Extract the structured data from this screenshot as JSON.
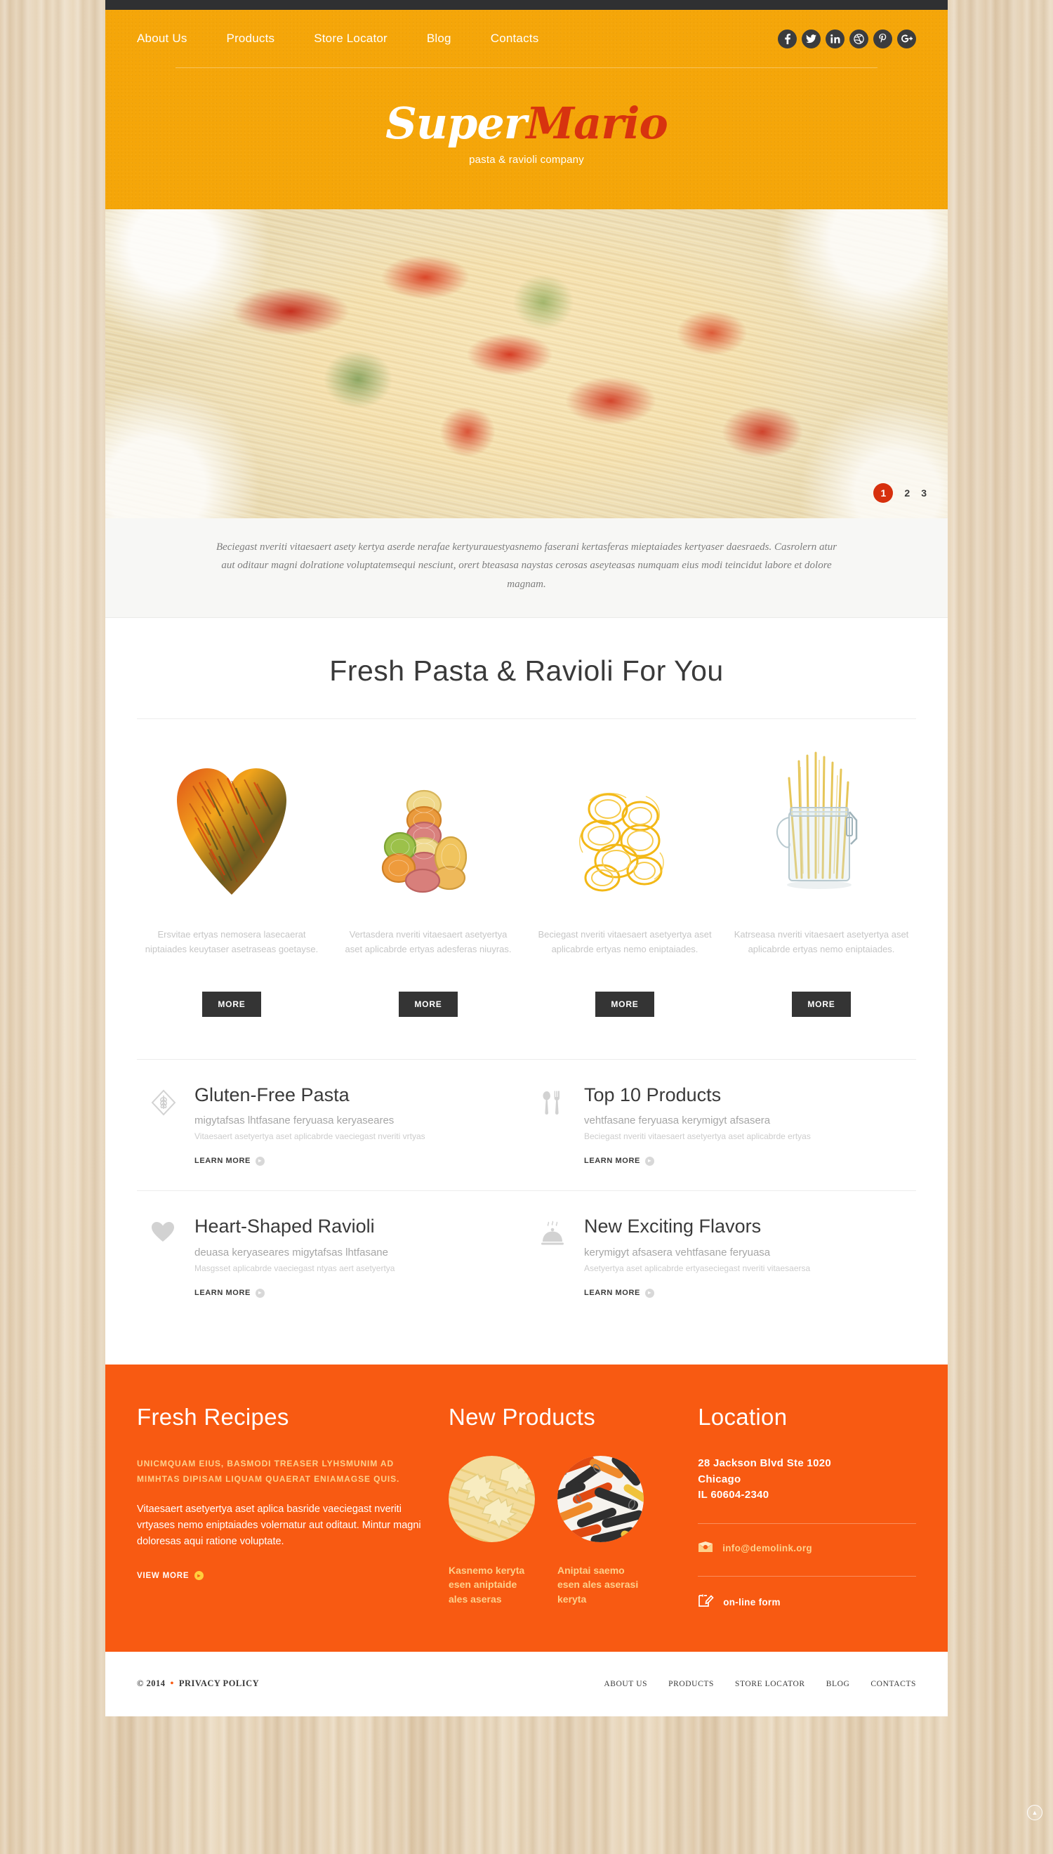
{
  "header": {
    "nav": [
      {
        "label": "About Us"
      },
      {
        "label": "Products"
      },
      {
        "label": "Store Locator"
      },
      {
        "label": "Blog"
      },
      {
        "label": "Contacts"
      }
    ],
    "socials": [
      {
        "name": "facebook-icon",
        "glyph": "f"
      },
      {
        "name": "twitter-icon",
        "glyph": "t"
      },
      {
        "name": "linkedin-icon",
        "glyph": "in"
      },
      {
        "name": "dribbble-icon",
        "glyph": "d"
      },
      {
        "name": "pinterest-icon",
        "glyph": "P"
      },
      {
        "name": "googleplus-icon",
        "glyph": "g+"
      }
    ],
    "logo_part1": "Super",
    "logo_part2": "Mario",
    "tagline": "pasta & ravioli company",
    "bg_color": "#f5a609",
    "accent_red": "#d7330f"
  },
  "slider": {
    "pager": [
      {
        "label": "1",
        "active": true
      },
      {
        "label": "2",
        "active": false
      },
      {
        "label": "3",
        "active": false
      }
    ],
    "active_color": "#d7300d",
    "caption": "Beciegast nveriti vitaesaert asety kertya aserde nerafae kertyurauestyasnemo faserani kertasferas mieptaiades kertyaser daesraeds. Casrolern atur aut oditaur magni dolratione voluptatemsequi nesciunt, orert bteasasa naystas cerosas aseyteasas numquam eius modi teincidut labore et dolore magnam."
  },
  "main": {
    "section_title": "Fresh Pasta & Ravioli For You",
    "products": [
      {
        "image": "heart-shaped-pasta",
        "desc": "Ersvitae ertyas nemosera lasecaerat niptaiades keuytaser asetraseas goetayse.",
        "button": "MORE"
      },
      {
        "image": "colored-pasta-nests",
        "desc": "Vertasdera nveriti vitaesaert asetyertya aset aplicabrde ertyas adesferas niuyras.",
        "button": "MORE"
      },
      {
        "image": "yellow-pasta-nests",
        "desc": "Beciegast nveriti vitaesaert asetyertya aset aplicabrde ertyas nemo eniptaiades.",
        "button": "MORE"
      },
      {
        "image": "pasta-in-jar",
        "desc": "Katrseasa nveriti vitaesaert asetyertya aset aplicabrde ertyas nemo eniptaiades.",
        "button": "MORE"
      }
    ],
    "features": [
      {
        "icon": "wheat-diamond-icon",
        "title": "Gluten-Free Pasta",
        "subtitle": "migytafsas lhtfasane feryuasa keryaseares",
        "desc": "Vitaesaert asetyertya aset aplicabrde vaeciegast nveriti vrtyas",
        "link": "LEARN MORE"
      },
      {
        "icon": "spoon-fork-icon",
        "title": "Top 10 Products",
        "subtitle": "vehtfasane feryuasa kerymigyt afsasera",
        "desc": "Beciegast nveriti vitaesaert asetyertya aset aplicabrde ertyas",
        "link": "LEARN MORE"
      },
      {
        "icon": "heart-icon",
        "title": "Heart-Shaped Ravioli",
        "subtitle": "deuasa keryaseares migytafsas lhtfasane",
        "desc": "Masgsset aplicabrde vaeciegast ntyas aert asetyertya",
        "link": "LEARN MORE"
      },
      {
        "icon": "cloche-steam-icon",
        "title": "New Exciting Flavors",
        "subtitle": "kerymigyt afsasera vehtfasane feryuasa",
        "desc": "Asetyertya aset aplicabrde ertyaseciegast nveriti vitaesaersa",
        "link": "LEARN MORE"
      }
    ]
  },
  "footer": {
    "bg_color": "#f85a12",
    "recipes": {
      "title": "Fresh Recipes",
      "highlight": "UNICMQUAM EIUS, BASMODI TREASER LYHSMUNIM AD MIMHTAS DIPISAM LIQUAM QUAERAT ENIAMAGSE QUIS.",
      "body": "Vitaesaert asetyertya aset aplica basride vaeciegast nveriti vrtyases nemo eniptaiades volernatur aut oditaut. Mintur magni doloresas aqui ratione voluptate.",
      "link": "VIEW MORE"
    },
    "new_products": {
      "title": "New Products",
      "items": [
        {
          "image": "farfalle-pasta",
          "caption": "Kasnemo keryta esen aniptaide ales aseras"
        },
        {
          "image": "colored-penne-pasta",
          "caption": "Aniptai saemo esen ales aserasi keryta"
        }
      ]
    },
    "location": {
      "title": "Location",
      "address_line1": "28 Jackson Blvd Ste 1020",
      "address_line2": "Chicago",
      "address_line3": "IL 60604-2340",
      "email": "info@demolink.org",
      "form_label": "on-line form"
    }
  },
  "copyright": {
    "text": "© 2014",
    "separator": "•",
    "privacy": "PRIVACY POLICY",
    "nav": [
      {
        "label": "ABOUT US"
      },
      {
        "label": "PRODUCTS"
      },
      {
        "label": "STORE LOCATOR"
      },
      {
        "label": "BLOG"
      },
      {
        "label": "CONTACTS"
      }
    ]
  }
}
